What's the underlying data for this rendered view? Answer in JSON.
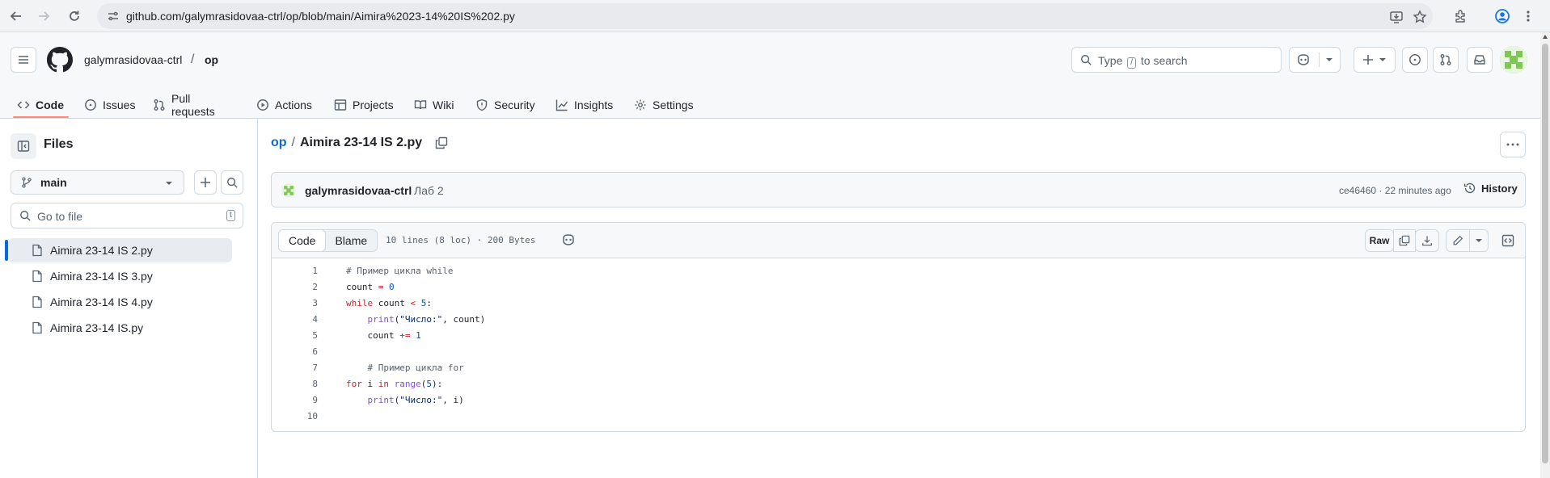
{
  "browser": {
    "url": "github.com/galymrasidovaa-ctrl/op/blob/main/Aimira%2023-14%20IS%202.py"
  },
  "header": {
    "owner": "galymrasidovaa-ctrl",
    "separator": "/",
    "repo": "op",
    "search_prefix": "Type",
    "search_key": "/",
    "search_suffix": "to search"
  },
  "repo_nav": {
    "code": "Code",
    "issues": "Issues",
    "pull_requests": "Pull requests",
    "actions": "Actions",
    "projects": "Projects",
    "wiki": "Wiki",
    "security": "Security",
    "insights": "Insights",
    "settings": "Settings"
  },
  "sidebar": {
    "title": "Files",
    "branch": "main",
    "goto_placeholder": "Go to file",
    "goto_key": "t",
    "files": [
      "Aimira 23-14 IS 2.py",
      "Aimira 23-14 IS 3.py",
      "Aimira 23-14 IS 4.py",
      "Aimira 23-14 IS.py"
    ]
  },
  "file": {
    "path_root": "op",
    "path_sep": "/",
    "name": "Aimira 23-14 IS 2.py"
  },
  "commit": {
    "author": "galymrasidovaa-ctrl",
    "message": "Лаб 2",
    "sha_time": "ce46460 · 22 minutes ago",
    "history": "History"
  },
  "code_view": {
    "tab_code": "Code",
    "tab_blame": "Blame",
    "meta": "10 lines (8 loc) · 200 Bytes",
    "raw": "Raw"
  },
  "code_lines": [
    {
      "n": "1",
      "seg": [
        {
          "t": "# Пример цикла while",
          "c": "tk-c"
        }
      ]
    },
    {
      "n": "2",
      "seg": [
        {
          "t": "count ",
          "c": ""
        },
        {
          "t": "=",
          "c": "tk-k"
        },
        {
          "t": " ",
          "c": ""
        },
        {
          "t": "0",
          "c": "tk-n"
        }
      ]
    },
    {
      "n": "3",
      "seg": [
        {
          "t": "while",
          "c": "tk-k"
        },
        {
          "t": " count ",
          "c": ""
        },
        {
          "t": "<",
          "c": "tk-k"
        },
        {
          "t": " ",
          "c": ""
        },
        {
          "t": "5",
          "c": "tk-n"
        },
        {
          "t": ":",
          "c": ""
        }
      ]
    },
    {
      "n": "4",
      "seg": [
        {
          "t": "    ",
          "c": ""
        },
        {
          "t": "print",
          "c": "tk-f"
        },
        {
          "t": "(",
          "c": ""
        },
        {
          "t": "\"Число:\"",
          "c": "tk-s"
        },
        {
          "t": ", count)",
          "c": ""
        }
      ]
    },
    {
      "n": "5",
      "seg": [
        {
          "t": "    count ",
          "c": ""
        },
        {
          "t": "+=",
          "c": "tk-k"
        },
        {
          "t": " ",
          "c": ""
        },
        {
          "t": "1",
          "c": "tk-n"
        }
      ]
    },
    {
      "n": "6",
      "seg": []
    },
    {
      "n": "7",
      "seg": [
        {
          "t": "    # Пример цикла for",
          "c": "tk-c"
        }
      ]
    },
    {
      "n": "8",
      "seg": [
        {
          "t": "for",
          "c": "tk-k"
        },
        {
          "t": " i ",
          "c": ""
        },
        {
          "t": "in",
          "c": "tk-k"
        },
        {
          "t": " ",
          "c": ""
        },
        {
          "t": "range",
          "c": "tk-f"
        },
        {
          "t": "(",
          "c": ""
        },
        {
          "t": "5",
          "c": "tk-n"
        },
        {
          "t": "):",
          "c": ""
        }
      ]
    },
    {
      "n": "9",
      "seg": [
        {
          "t": "    ",
          "c": ""
        },
        {
          "t": "print",
          "c": "tk-f"
        },
        {
          "t": "(",
          "c": ""
        },
        {
          "t": "\"Число:\"",
          "c": "tk-s"
        },
        {
          "t": ", i)",
          "c": ""
        }
      ]
    },
    {
      "n": "10",
      "seg": []
    }
  ],
  "colors": {
    "accent": "#0969da",
    "tab_underline": "#fd8c73",
    "active_file_bar": "#0969da"
  }
}
